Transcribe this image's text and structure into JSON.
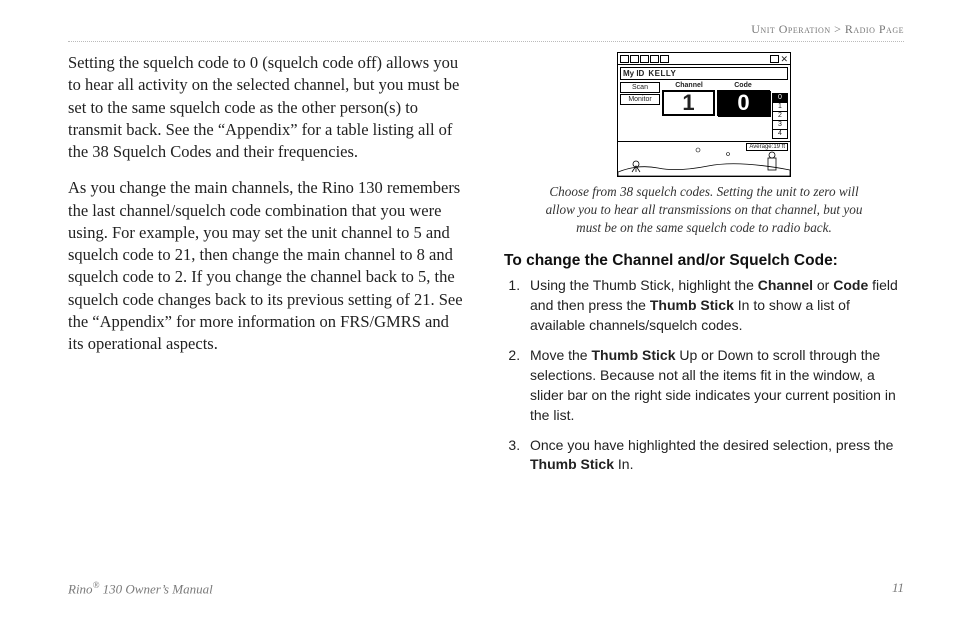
{
  "breadcrumb": {
    "section": "Unit Operation",
    "separator": ">",
    "page": "Radio Page"
  },
  "left_col": {
    "para1": "Setting the squelch code to 0 (squelch code off) allows you to hear all activity on the selected channel, but you must be set to the same squelch code as the other person(s) to transmit back. See the “Appendix” for a table listing all of the 38 Squelch Codes and their frequencies.",
    "para2": "As you change the main channels, the Rino 130 remembers the last channel/squelch code combination that you were using. For example, you may set the unit channel to 5 and squelch code to 21, then change the main channel to 8 and squelch code to 2. If you change the channel back to 5, the squelch code changes back to its previous setting of 21. See the “Appendix” for more information on FRS/GMRS and its operational aspects."
  },
  "device": {
    "myid_label": "My ID",
    "myid_value": "KELLY",
    "chan_label": "Channel",
    "code_label": "Code",
    "channel": "1",
    "code": "0",
    "scan": "Scan",
    "monitor": "Monitor",
    "avg": "Average:19 ft",
    "list": [
      "0",
      "1",
      "2",
      "3",
      "4"
    ]
  },
  "caption": "Choose from 38 squelch codes. Setting the unit to zero will allow you to hear all transmissions on that channel, but you must be on the same squelch code to radio back.",
  "subhead": "To change the Channel and/or Squelch Code:",
  "steps": {
    "s1_a": "Using the Thumb Stick, highlight the ",
    "s1_b_channel": "Channel",
    "s1_c": " or ",
    "s1_d_code": "Code",
    "s1_e": " field and then press the ",
    "s1_f_ts": "Thumb Stick",
    "s1_g": " In to show a list of available channels/squelch codes.",
    "s2_a": "Move the ",
    "s2_b_ts": "Thumb Stick",
    "s2_c": " Up or Down to scroll through the selections. Because not all the items fit in the window, a slider bar on the right side indicates your current position in the list.",
    "s3_a": "Once you have highlighted the desired selection, press the ",
    "s3_b_ts": "Thumb Stick",
    "s3_c": " In."
  },
  "footer": {
    "left_a": "Rino",
    "left_sup": "®",
    "left_b": " 130 Owner’s Manual",
    "page_no": "11"
  }
}
